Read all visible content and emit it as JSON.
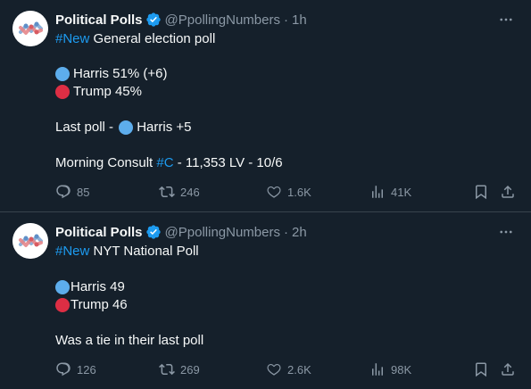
{
  "tweets": [
    {
      "author": {
        "name": "Political Polls",
        "handle": "@PpollingNumbers",
        "time": "1h"
      },
      "lines": {
        "hashtag": "#New",
        "headline": " General election poll",
        "harris": "Harris 51% (+6)",
        "trump": "Trump 45%",
        "last_prefix": "Last poll - ",
        "last_value": "Harris +5",
        "source_prefix": "Morning Consult ",
        "source_tag": "#C",
        "source_suffix": " - 11,353 LV - 10/6"
      },
      "stats": {
        "replies": "85",
        "reposts": "246",
        "likes": "1.6K",
        "views": "41K"
      }
    },
    {
      "author": {
        "name": "Political Polls",
        "handle": "@PpollingNumbers",
        "time": "2h"
      },
      "lines": {
        "hashtag": "#New",
        "headline": " NYT National Poll",
        "harris": "Harris 49",
        "trump": "Trump 46",
        "note": "Was a tie in their last poll"
      },
      "stats": {
        "replies": "126",
        "reposts": "269",
        "likes": "2.6K",
        "views": "98K"
      }
    }
  ],
  "colors": {
    "background": "#15202b",
    "text": "#f7f9f9",
    "muted": "#8b98a5",
    "accent": "#1d9bf0",
    "harris_circle": "#5dadec",
    "trump_circle": "#dd2e44"
  },
  "icons": [
    "verified-badge-icon",
    "more-icon",
    "reply-icon",
    "repost-icon",
    "like-icon",
    "views-icon",
    "bookmark-icon",
    "share-icon"
  ]
}
